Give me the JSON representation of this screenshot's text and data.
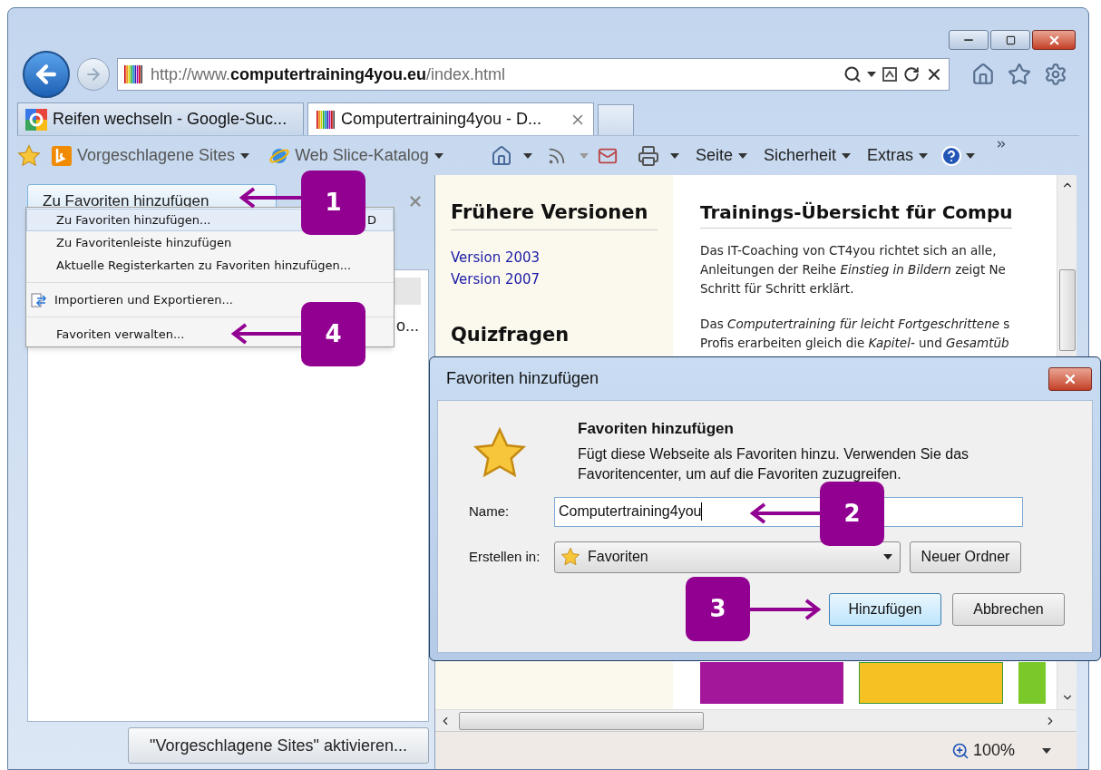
{
  "address_bar": {
    "url": "http://www.**computertraining4you.eu**/index.html"
  },
  "tabs": [
    {
      "label": "Reifen wechseln - Google-Suc...",
      "selected": false
    },
    {
      "label": "Computertraining4you - D...",
      "selected": true
    }
  ],
  "command_bar": {
    "links": [
      "Vorgeschlagene Sites",
      "Web Slice-Katalog"
    ],
    "menus": [
      "Seite",
      "Sicherheit",
      "Extras"
    ]
  },
  "favorites_pane": {
    "add_button": "Zu Favoriten hinzufügen",
    "list_items": [
      "o..."
    ],
    "suggest_button": "\"Vorgeschlagene Sites\" aktivieren..."
  },
  "menu": {
    "groups": [
      [
        {
          "label": "Zu Favoriten hinzufügen...",
          "shortcut": "D",
          "selected": true
        },
        {
          "label": "Zu Favoritenleiste hinzufügen",
          "selected": false
        },
        {
          "label": "Aktuelle Registerkarten zu Favoriten hinzufügen...",
          "selected": false
        }
      ],
      [
        {
          "label": "Importieren und Exportieren...",
          "selected": false
        }
      ],
      [
        {
          "label": "Favoriten verwalten...",
          "selected": false
        }
      ]
    ]
  },
  "page": {
    "sidebar": {
      "heading": "Frühere Versionen",
      "links": [
        "Version 2003",
        "Version 2007"
      ],
      "heading_2": "Quizfragen"
    },
    "main": {
      "heading": "Trainings-Übersicht für Compu",
      "paragraphs": [
        [
          "Das IT-Coaching von CT4you richtet sich an alle,",
          "Anleitungen der Reihe *Einstieg in Bildern* zeigt Ne",
          "Schritt für Schritt erklärt."
        ],
        [
          "Das *Computertraining für leicht Fortgeschrittene* s",
          "Profis erarbeiten gleich die *Kapitel-* und *Gesamtüb*"
        ]
      ]
    }
  },
  "status_bar": {
    "zoom": "100%"
  },
  "dialog": {
    "title": "Favoriten hinzufügen",
    "heading": "Favoriten hinzufügen",
    "description": "Fügt diese Webseite als Favoriten hinzu. Verwenden Sie das Favoritencenter, um auf die Favoriten zuzugreifen.",
    "name_label": "Name:",
    "name_value": "Computertraining4you",
    "folder_label": "Erstellen in:",
    "folder_value": "Favoriten",
    "new_folder_button": "Neuer Ordner",
    "buttons": [
      {
        "label": "Hinzufügen",
        "default": true
      },
      {
        "label": "Abbrechen",
        "default": false
      }
    ]
  },
  "callouts": [
    {
      "label": "1"
    },
    {
      "label": "4"
    },
    {
      "label": "2"
    },
    {
      "label": "3"
    }
  ]
}
